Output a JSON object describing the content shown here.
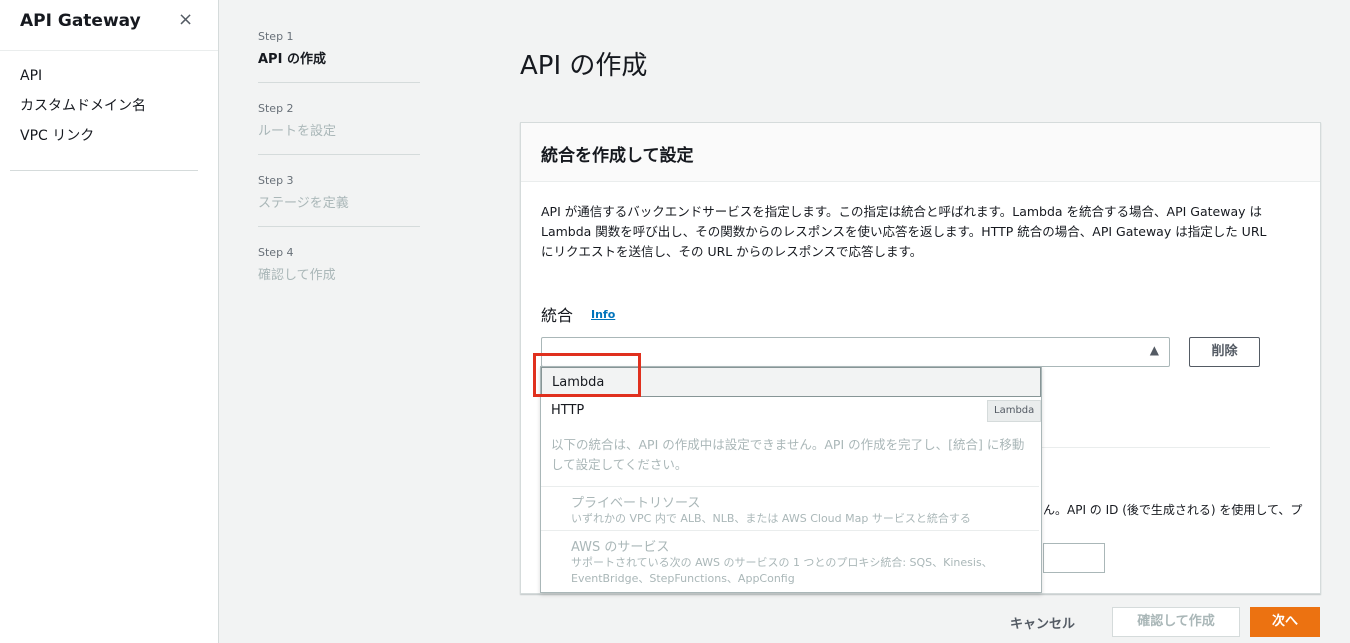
{
  "sidebar": {
    "title": "API Gateway",
    "close_icon": "×",
    "items": [
      {
        "label": "API"
      },
      {
        "label": "カスタムドメイン名"
      },
      {
        "label": "VPC リンク"
      }
    ]
  },
  "steps": [
    {
      "num": "Step 1",
      "title": "API の作成",
      "active": true
    },
    {
      "num": "Step 2",
      "title": "ルートを設定"
    },
    {
      "num": "Step 3",
      "title": "ステージを定義"
    },
    {
      "num": "Step 4",
      "title": "確認して作成"
    }
  ],
  "page": {
    "title": "API の作成"
  },
  "panel": {
    "header": "統合を作成して設定",
    "description": "API が通信するバックエンドサービスを指定します。この指定は統合と呼ばれます。Lambda を統合する場合、API Gateway は Lambda 関数を呼び出し、その関数からのレスポンスを使い応答を返します。HTTP 統合の場合、API Gateway は指定した URL にリクエストを送信し、その URL からのレスポンスで応答します。",
    "integration_label": "統合",
    "info_link": "Info",
    "select_caret": "▲",
    "delete_button": "削除",
    "hidden_text": "ん。API の ID (後で生成される) を使用して、プ"
  },
  "dropdown": {
    "options": [
      {
        "label": "Lambda",
        "highlighted": true
      },
      {
        "label": "HTTP"
      }
    ],
    "note": "以下の統合は、API の作成中は設定できません。API の作成を完了し、[統合] に移動して設定してください。",
    "groups": [
      {
        "title": "プライベートリソース",
        "description": "いずれかの VPC 内で ALB、NLB、または AWS Cloud Map サービスと統合する"
      },
      {
        "title": "AWS のサービス",
        "description": "サポートされている次の AWS のサービスの 1 つとのプロキシ統合: SQS、Kinesis、EventBridge、StepFunctions、AppConfig"
      }
    ],
    "tooltip": "Lambda"
  },
  "footer": {
    "cancel": "キャンセル",
    "review": "確認して作成",
    "next": "次へ"
  },
  "colors": {
    "accent": "#ec7211",
    "link": "#0073bb",
    "highlight": "#e0301e"
  }
}
